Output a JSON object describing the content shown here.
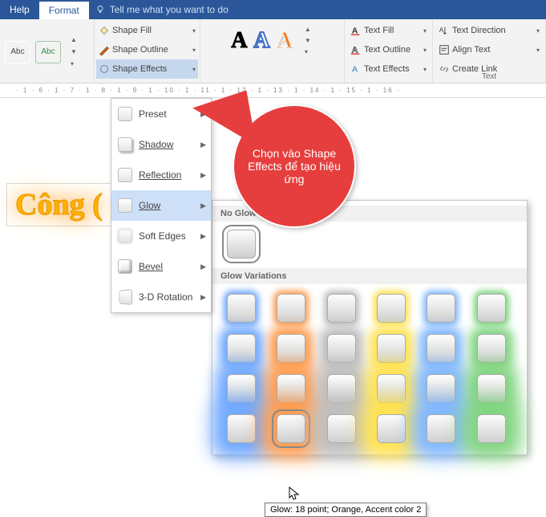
{
  "tabs": {
    "help": "Help",
    "format": "Format",
    "tellme": "Tell me what you want to do"
  },
  "shapes": {
    "box1": "Abc",
    "box2": "Abc"
  },
  "shape_style": {
    "fill": "Shape Fill",
    "outline": "Shape Outline",
    "effects": "Shape Effects"
  },
  "wordart": {
    "a1": "A",
    "a2": "A",
    "a3": "A"
  },
  "textfmt": {
    "fill": "Text Fill",
    "outline": "Text Outline",
    "effects": "Text Effects"
  },
  "textalign": {
    "dir": "Text Direction",
    "align": "Align Text",
    "link": "Create Link",
    "group": "Text"
  },
  "ruler": "· 1 · 6 · 1 · 7 · 1 · 8 · 1 · 9 · 1 · 10 · 1 · 11 · 1 · 12 · 1 · 13 · 1 · 14 · 1 · 15 · 1 · 16 ·",
  "sample": "Công (",
  "fx": {
    "preset": "Preset",
    "shadow": "Shadow",
    "reflection": "Reflection",
    "glow": "Glow",
    "soft": "Soft Edges",
    "bevel": "Bevel",
    "rotation": "3-D Rotation"
  },
  "callout": "Chọn vào Shape Effects để tạo hiệu ứng",
  "glow": {
    "no": "No Glow",
    "var": "Glow Variations"
  },
  "glow_colors": [
    "#6fa8ff",
    "#ff9b4d",
    "#bdbdbd",
    "#ffe24d",
    "#7fb7ff",
    "#7fd47f"
  ],
  "tooltip": "Glow: 18 point; Orange, Accent color 2"
}
